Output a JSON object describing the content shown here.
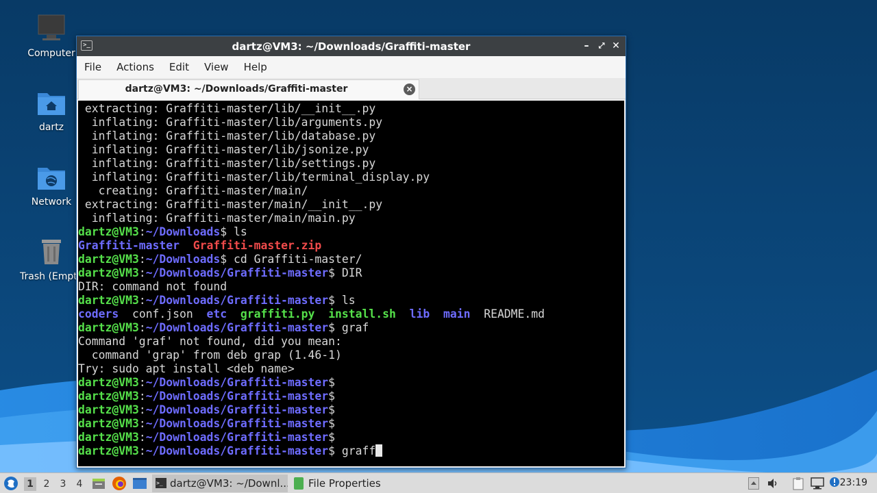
{
  "desktop": {
    "icons": [
      {
        "label": "Computer"
      },
      {
        "label": "dartz"
      },
      {
        "label": "Network"
      },
      {
        "label": "Trash (Empt"
      }
    ]
  },
  "window": {
    "title": "dartz@VM3: ~/Downloads/Graffiti-master",
    "menu": [
      "File",
      "Actions",
      "Edit",
      "View",
      "Help"
    ],
    "tab_label": "dartz@VM3: ~/Downloads/Graffiti-master"
  },
  "terminal": {
    "user": "dartz@VM3",
    "lines": [
      {
        "text": " extracting: Graffiti-master/lib/__init__.py"
      },
      {
        "text": "  inflating: Graffiti-master/lib/arguments.py"
      },
      {
        "text": "  inflating: Graffiti-master/lib/database.py"
      },
      {
        "text": "  inflating: Graffiti-master/lib/jsonize.py"
      },
      {
        "text": "  inflating: Graffiti-master/lib/settings.py"
      },
      {
        "text": "  inflating: Graffiti-master/lib/terminal_display.py"
      },
      {
        "text": "   creating: Graffiti-master/main/"
      },
      {
        "text": " extracting: Graffiti-master/main/__init__.py"
      },
      {
        "text": "  inflating: Graffiti-master/main/main.py"
      },
      {
        "prompt": true,
        "path": "~/Downloads",
        "cmd": " ls"
      },
      {
        "ls": [
          {
            "name": "Graffiti-master",
            "kind": "dir"
          },
          {
            "name": "  ",
            "kind": "plain"
          },
          {
            "name": "Graffiti-master.zip",
            "kind": "arc"
          }
        ]
      },
      {
        "prompt": true,
        "path": "~/Downloads",
        "cmd": " cd Graffiti-master/"
      },
      {
        "prompt": true,
        "path": "~/Downloads/Graffiti-master",
        "cmd": " DIR"
      },
      {
        "text": "DIR: command not found"
      },
      {
        "prompt": true,
        "path": "~/Downloads/Graffiti-master",
        "cmd": " ls"
      },
      {
        "ls": [
          {
            "name": "coders",
            "kind": "dir"
          },
          {
            "name": "  conf.json  ",
            "kind": "plain"
          },
          {
            "name": "etc",
            "kind": "dir"
          },
          {
            "name": "  ",
            "kind": "plain"
          },
          {
            "name": "graffiti.py",
            "kind": "exe"
          },
          {
            "name": "  ",
            "kind": "plain"
          },
          {
            "name": "install.sh",
            "kind": "exe"
          },
          {
            "name": "  ",
            "kind": "plain"
          },
          {
            "name": "lib",
            "kind": "dir"
          },
          {
            "name": "  ",
            "kind": "plain"
          },
          {
            "name": "main",
            "kind": "dir"
          },
          {
            "name": "  README.md",
            "kind": "plain"
          }
        ]
      },
      {
        "prompt": true,
        "path": "~/Downloads/Graffiti-master",
        "cmd": " graf"
      },
      {
        "text": "Command 'graf' not found, did you mean:"
      },
      {
        "text": "  command 'grap' from deb grap (1.46-1)"
      },
      {
        "text": "Try: sudo apt install <deb name>"
      },
      {
        "prompt": true,
        "path": "~/Downloads/Graffiti-master",
        "cmd": ""
      },
      {
        "prompt": true,
        "path": "~/Downloads/Graffiti-master",
        "cmd": ""
      },
      {
        "prompt": true,
        "path": "~/Downloads/Graffiti-master",
        "cmd": ""
      },
      {
        "prompt": true,
        "path": "~/Downloads/Graffiti-master",
        "cmd": ""
      },
      {
        "prompt": true,
        "path": "~/Downloads/Graffiti-master",
        "cmd": ""
      },
      {
        "prompt": true,
        "path": "~/Downloads/Graffiti-master",
        "cmd": " graff",
        "cursor": true
      }
    ]
  },
  "taskbar": {
    "workspaces": [
      "1",
      "2",
      "3",
      "4"
    ],
    "tasks": [
      {
        "label": "dartz@VM3: ~/Downl..."
      },
      {
        "label": "File Properties"
      }
    ],
    "clock": "23:19"
  },
  "colors": {
    "prompt_user": "#55e04a",
    "prompt_path": "#6e6cff",
    "archive": "#f04b4b",
    "titlebar": "#3c4043"
  }
}
